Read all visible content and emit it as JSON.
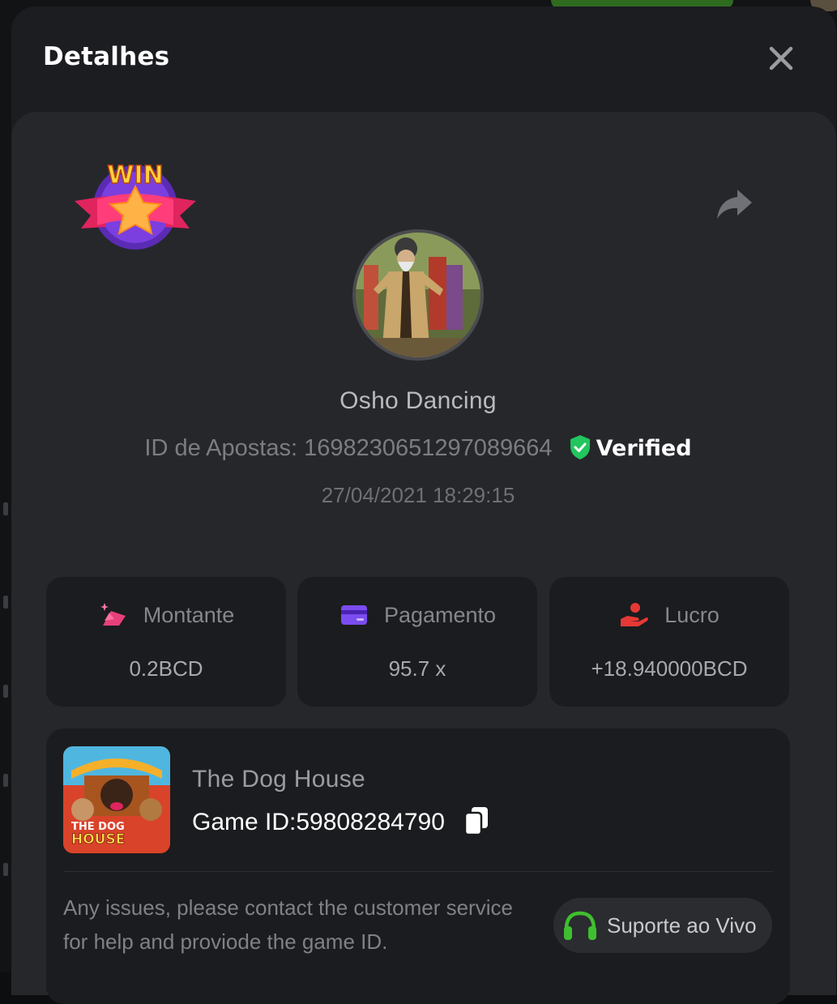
{
  "modal": {
    "title": "Detalhes"
  },
  "bet": {
    "username": "Osho Dancing",
    "bet_id_label": "ID de Apostas:",
    "bet_id": "1698230651297089664",
    "verified_label": "Verified",
    "timestamp": "27/04/2021 18:29:15",
    "badge_text": "WIN"
  },
  "stats": [
    {
      "label": "Montante",
      "value": "0.2BCD",
      "icon": "money-bag-icon",
      "color": "#e8407a"
    },
    {
      "label": "Pagamento",
      "value": "95.7 x",
      "icon": "card-icon",
      "color": "#7b4cf0"
    },
    {
      "label": "Lucro",
      "value": "+18.940000BCD",
      "icon": "profit-hand-icon",
      "color": "#e53935"
    }
  ],
  "game": {
    "name": "The Dog House",
    "id_label": "Game ID:",
    "id": "59808284790",
    "thumb_text_1": "THE DOG",
    "thumb_text_2": "HOUSE"
  },
  "support": {
    "help_text": "Any issues, please contact the customer service for help and proviode the game ID.",
    "button_label": "Suporte ao Vivo"
  },
  "colors": {
    "accent_green": "#3fbf2f",
    "verified_green": "#22c55e"
  }
}
